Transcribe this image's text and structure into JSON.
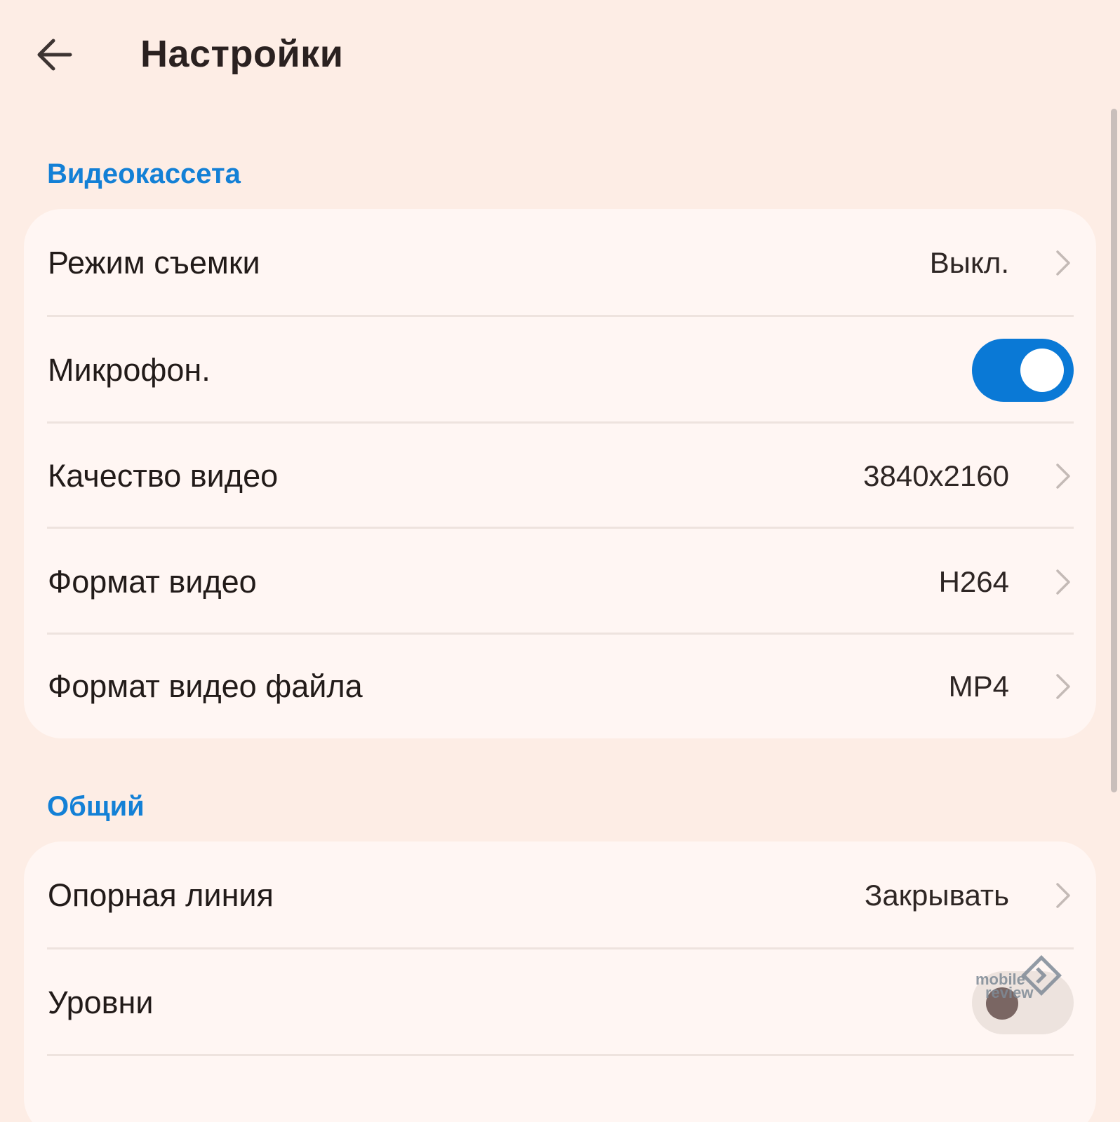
{
  "header": {
    "title": "Настройки",
    "back_icon": "arrow-left-icon"
  },
  "sections": [
    {
      "title": "Видеокассета",
      "rows": [
        {
          "label": "Режим съемки",
          "value": "Выкл.",
          "type": "chevron"
        },
        {
          "label": "Микрофон.",
          "type": "toggle",
          "state": "on"
        },
        {
          "label": "Качество видео",
          "value": "3840x2160",
          "type": "chevron"
        },
        {
          "label": "Формат видео",
          "value": "H264",
          "type": "chevron"
        },
        {
          "label": "Формат видео файла",
          "value": "MP4",
          "type": "chevron"
        }
      ]
    },
    {
      "title": "Общий",
      "rows": [
        {
          "label": "Опорная линия",
          "value": "Закрывать",
          "type": "chevron"
        },
        {
          "label": "Уровни",
          "type": "toggle",
          "state": "off"
        }
      ]
    }
  ],
  "watermark": {
    "line1": "mobile",
    "line2": "review"
  },
  "colors": {
    "background": "#fdede5",
    "card": "#fff6f3",
    "accent": "#1380d6",
    "toggle_on": "#0a79d6",
    "toggle_off": "#ede3de"
  }
}
